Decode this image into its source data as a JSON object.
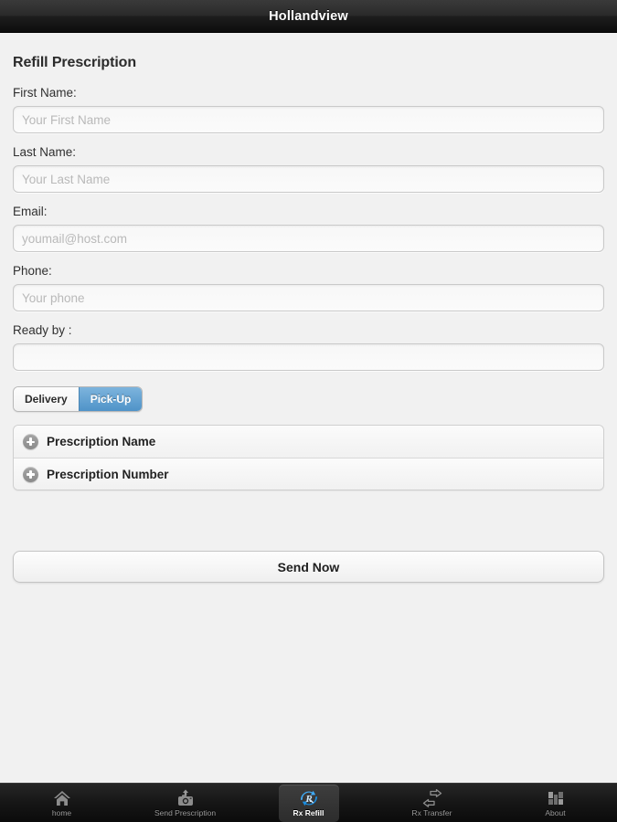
{
  "header": {
    "title": "Hollandview"
  },
  "page": {
    "heading": "Refill Prescription"
  },
  "form": {
    "fields": [
      {
        "label": "First Name:",
        "placeholder": "Your First Name",
        "value": "",
        "name": "first-name"
      },
      {
        "label": "Last Name:",
        "placeholder": "Your Last Name",
        "value": "",
        "name": "last-name"
      },
      {
        "label": "Email:",
        "placeholder": "youmail@host.com",
        "value": "",
        "name": "email"
      },
      {
        "label": "Phone:",
        "placeholder": "Your phone",
        "value": "",
        "name": "phone"
      },
      {
        "label": "Ready by :",
        "placeholder": "",
        "value": "",
        "name": "ready-by"
      }
    ],
    "delivery_options": [
      {
        "label": "Delivery",
        "selected": false
      },
      {
        "label": "Pick-Up",
        "selected": true
      }
    ],
    "accordion": [
      {
        "label": "Prescription Name",
        "icon": "plus-circle-icon"
      },
      {
        "label": "Prescription Number",
        "icon": "plus-circle-icon"
      }
    ],
    "submit_label": "Send Now"
  },
  "tabbar": {
    "tabs": [
      {
        "label": "home",
        "icon": "home-icon",
        "active": false
      },
      {
        "label": "Send Prescription",
        "icon": "camera-upload-icon",
        "active": false
      },
      {
        "label": "Rx Refill",
        "icon": "rx-refresh-icon",
        "active": true
      },
      {
        "label": "Rx Transfer",
        "icon": "transfer-arrows-icon",
        "active": false
      },
      {
        "label": "About",
        "icon": "n-logo-icon",
        "active": false
      }
    ]
  },
  "colors": {
    "accent_blue": "#4f93c8",
    "header_dark": "#1d1d1d",
    "page_bg": "#f1f1f1",
    "tabbar_bg": "#161616"
  }
}
